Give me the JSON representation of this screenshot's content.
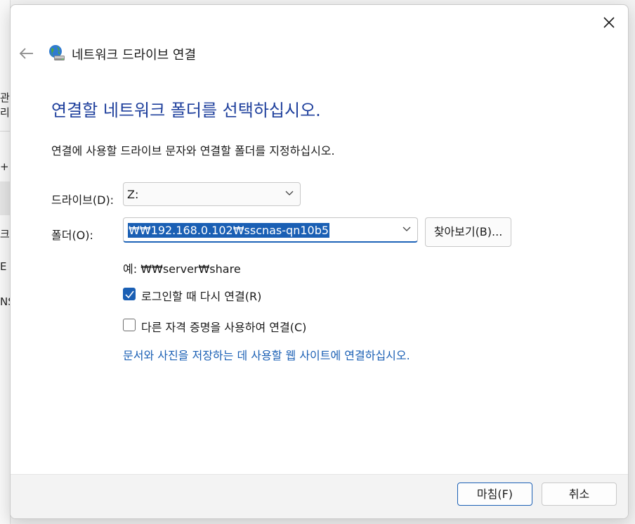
{
  "background_app": {
    "fragments": [
      "관리",
      "+",
      "크",
      "E",
      "NS"
    ]
  },
  "dialog": {
    "title": "네트워크 드라이브 연결",
    "icons": {
      "close": "close-icon",
      "back": "back-arrow-icon",
      "title": "network-drive-globe-icon"
    }
  },
  "main": {
    "heading": "연결할 네트워크 폴더를 선택하십시오.",
    "description": "연결에 사용할 드라이브 문자와 연결할 폴더를 지정하십시오.",
    "drive_label": "드라이브(D):",
    "drive_value": "Z:",
    "folder_label": "폴더(O):",
    "folder_value": "₩₩192.168.0.102₩sscnas-qn10b5",
    "browse_label": "찾아보기(B)...",
    "example": "예: ₩₩server₩share",
    "reconnect_label": "로그인할 때 다시 연결(R)",
    "reconnect_checked": true,
    "credentials_label": "다른 자격 증명을 사용하여 연결(C)",
    "credentials_checked": false,
    "link_text": "문서와 사진을 저장하는 데 사용할 웹 사이트에 연결하십시오."
  },
  "footer": {
    "finish_label": "마침(F)",
    "cancel_label": "취소"
  },
  "colors": {
    "heading": "#1e3f9c",
    "accent": "#1a5fb4",
    "link": "#1a5fb4",
    "footer_bg": "#f3f3f3"
  }
}
